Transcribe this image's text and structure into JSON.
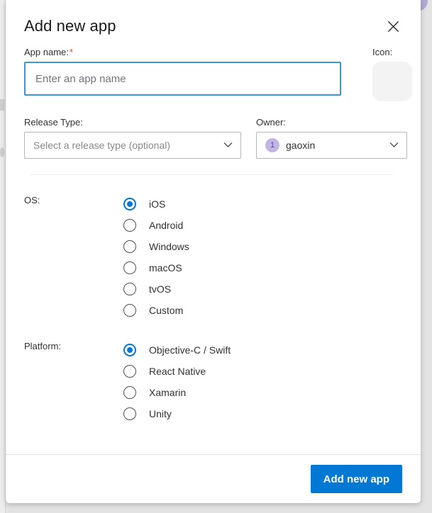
{
  "dialog": {
    "title": "Add new app",
    "close_icon": "close-icon"
  },
  "app_name": {
    "label": "App name:",
    "required_marker": "*",
    "value": "",
    "placeholder": "Enter an app name"
  },
  "icon": {
    "label": "Icon:"
  },
  "release_type": {
    "label": "Release Type:",
    "value": "",
    "placeholder": "Select a release type (optional)"
  },
  "owner": {
    "label": "Owner:",
    "avatar_initial": "1",
    "value": "gaoxin"
  },
  "os": {
    "label": "OS:",
    "selected": "iOS",
    "options": [
      {
        "label": "iOS",
        "selected": true
      },
      {
        "label": "Android",
        "selected": false
      },
      {
        "label": "Windows",
        "selected": false
      },
      {
        "label": "macOS",
        "selected": false
      },
      {
        "label": "tvOS",
        "selected": false
      },
      {
        "label": "Custom",
        "selected": false
      }
    ]
  },
  "platform": {
    "label": "Platform:",
    "selected": "Objective-C / Swift",
    "options": [
      {
        "label": "Objective-C / Swift",
        "selected": true
      },
      {
        "label": "React Native",
        "selected": false
      },
      {
        "label": "Xamarin",
        "selected": false
      },
      {
        "label": "Unity",
        "selected": false
      }
    ]
  },
  "footer": {
    "submit_label": "Add new app"
  },
  "colors": {
    "accent": "#0078d4",
    "focus_border": "#3a96dd",
    "required": "#e3453c",
    "avatar_bg": "#c3b5e3"
  }
}
